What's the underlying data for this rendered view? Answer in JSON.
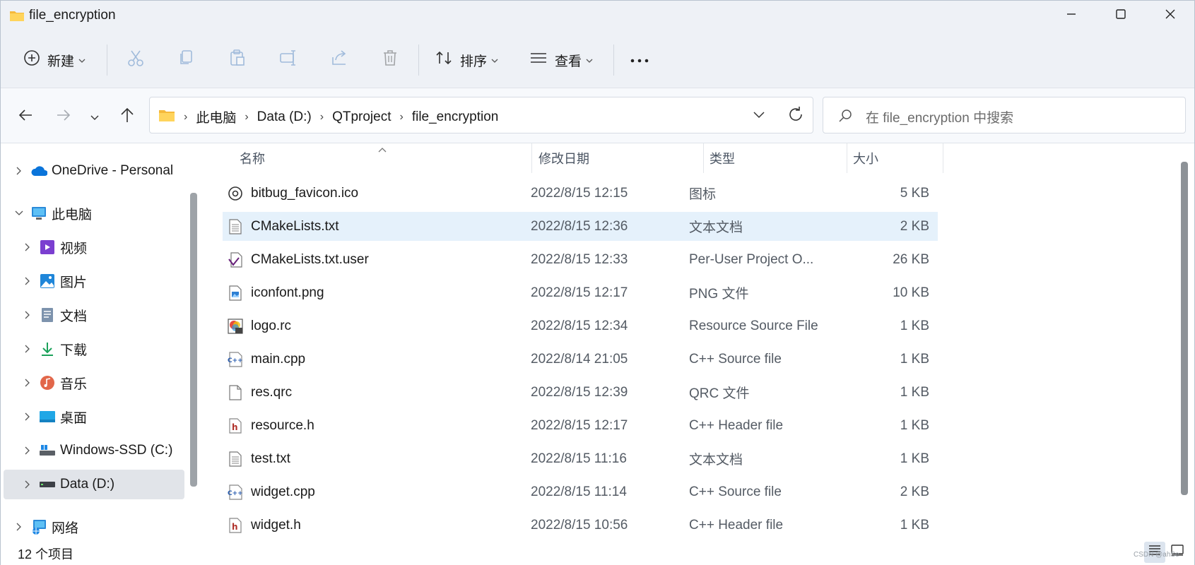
{
  "window": {
    "title": "file_encryption",
    "minimize_icon": "minimize-icon",
    "maximize_icon": "maximize-icon",
    "close_icon": "close-icon"
  },
  "toolbar": {
    "new_label": "新建",
    "sort_label": "排序",
    "view_label": "查看",
    "more_icon": "more-icon",
    "disabled_actions": [
      "cut-icon",
      "copy-icon",
      "paste-icon",
      "rename-icon",
      "share-icon",
      "delete-icon"
    ]
  },
  "address": {
    "breadcrumbs": [
      "此电脑",
      "Data (D:)",
      "QTproject",
      "file_encryption"
    ]
  },
  "search": {
    "placeholder": "在 file_encryption 中搜索"
  },
  "sidebar": {
    "items": [
      {
        "label": "OneDrive - Personal",
        "icon": "onedrive-icon",
        "expanded": false
      },
      {
        "label": "此电脑",
        "icon": "pc-icon",
        "expanded": true
      },
      {
        "label": "视频",
        "icon": "video-icon",
        "expanded": false
      },
      {
        "label": "图片",
        "icon": "pictures-icon",
        "expanded": false
      },
      {
        "label": "文档",
        "icon": "documents-icon",
        "expanded": false
      },
      {
        "label": "下载",
        "icon": "download-icon",
        "expanded": false
      },
      {
        "label": "音乐",
        "icon": "music-icon",
        "expanded": false
      },
      {
        "label": "桌面",
        "icon": "desktop-icon",
        "expanded": false
      },
      {
        "label": "Windows-SSD (C:)",
        "icon": "drive-c-icon",
        "expanded": false
      },
      {
        "label": "Data (D:)",
        "icon": "drive-d-icon",
        "expanded": false,
        "selected": true
      },
      {
        "label": "网络",
        "icon": "network-icon",
        "expanded": false
      }
    ]
  },
  "columns": {
    "name": "名称",
    "date": "修改日期",
    "type": "类型",
    "size": "大小"
  },
  "files": [
    {
      "name": "bitbug_favicon.ico",
      "date": "2022/8/15 12:15",
      "type": "图标",
      "size": "5 KB",
      "icon": "ico-file-icon"
    },
    {
      "name": "CMakeLists.txt",
      "date": "2022/8/15 12:36",
      "type": "文本文档",
      "size": "2 KB",
      "icon": "text-file-icon",
      "selected": true
    },
    {
      "name": "CMakeLists.txt.user",
      "date": "2022/8/15 12:33",
      "type": "Per-User Project O...",
      "size": "26 KB",
      "icon": "vs-file-icon"
    },
    {
      "name": "iconfont.png",
      "date": "2022/8/15 12:17",
      "type": "PNG 文件",
      "size": "10 KB",
      "icon": "image-file-icon"
    },
    {
      "name": "logo.rc",
      "date": "2022/8/15 12:34",
      "type": "Resource Source File",
      "size": "1 KB",
      "icon": "rc-file-icon"
    },
    {
      "name": "main.cpp",
      "date": "2022/8/14 21:05",
      "type": "C++ Source file",
      "size": "1 KB",
      "icon": "cpp-file-icon"
    },
    {
      "name": "res.qrc",
      "date": "2022/8/15 12:39",
      "type": "QRC 文件",
      "size": "1 KB",
      "icon": "blank-file-icon"
    },
    {
      "name": "resource.h",
      "date": "2022/8/15 12:17",
      "type": "C++ Header file",
      "size": "1 KB",
      "icon": "header-file-icon"
    },
    {
      "name": "test.txt",
      "date": "2022/8/15 11:16",
      "type": "文本文档",
      "size": "1 KB",
      "icon": "text-file-icon"
    },
    {
      "name": "widget.cpp",
      "date": "2022/8/15 11:14",
      "type": "C++ Source file",
      "size": "2 KB",
      "icon": "cpp-file-icon"
    },
    {
      "name": "widget.h",
      "date": "2022/8/15 10:56",
      "type": "C++ Header file",
      "size": "1 KB",
      "icon": "header-file-icon"
    }
  ],
  "status": {
    "count": "12 个项目"
  },
  "watermark": "CSDN @ahSe",
  "colors": {
    "accent": "#0067c0",
    "selected_row": "#e5f1fb",
    "chrome_bg": "#eef1f6",
    "folder": "#f8c94a"
  }
}
